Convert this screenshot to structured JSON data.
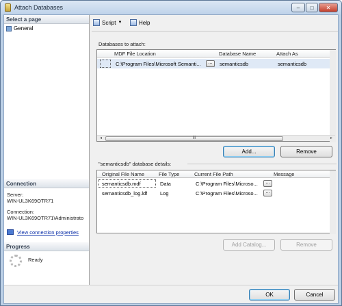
{
  "window": {
    "title": "Attach Databases",
    "minimize": "–",
    "maximize": "□",
    "close": "✕"
  },
  "left": {
    "select_page": "Select a page",
    "pages": [
      "General"
    ],
    "connection_header": "Connection",
    "server_label": "Server:",
    "server_value": "WIN-UL3K69OTR71",
    "connection_label": "Connection:",
    "connection_value": "WIN-UL3K69OTR71\\Administrato",
    "view_connection": "View connection properties",
    "progress_header": "Progress",
    "progress_status": "Ready"
  },
  "toolbar": {
    "script": "Script",
    "help": "Help"
  },
  "attach": {
    "label": "Databases to attach:",
    "columns": [
      "MDF File Location",
      "Database Name",
      "Attach As"
    ],
    "rows": [
      {
        "location": "C:\\Program Files\\Microsoft Semanti...",
        "database_name": "semanticsdb",
        "attach_as": "semanticsdb"
      }
    ],
    "browse": "...",
    "scroll_left": "◂",
    "scroll_right": "▸",
    "thumb": "III",
    "add": "Add...",
    "remove": "Remove"
  },
  "details": {
    "label": "\"semanticsdb\" database details:",
    "columns": [
      "Original File Name",
      "File Type",
      "Current File Path",
      "Message"
    ],
    "rows": [
      {
        "name": "semanticsdb.mdf",
        "type": "Data",
        "path": "C:\\Program Files\\Microso...",
        "message": ""
      },
      {
        "name": "semanticsdb_log.ldf",
        "type": "Log",
        "path": "C:\\Program Files\\Microso...",
        "message": ""
      }
    ],
    "browse": "...",
    "add_catalog": "Add Catalog...",
    "remove": "Remove"
  },
  "footer": {
    "ok": "OK",
    "cancel": "Cancel"
  }
}
